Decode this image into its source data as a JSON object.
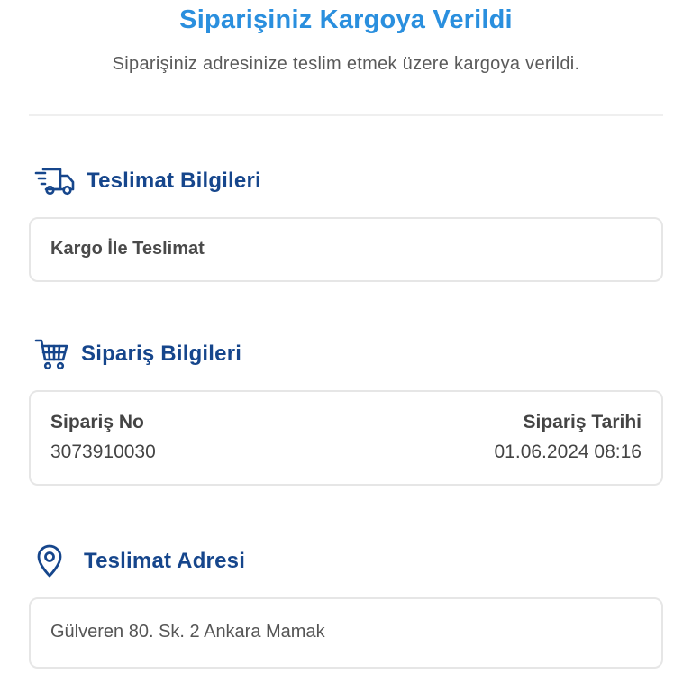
{
  "header": {
    "title": "Siparişiniz Kargoya Verildi",
    "subtitle": "Siparişiniz adresinize teslim etmek üzere kargoya verildi."
  },
  "delivery": {
    "icon": "delivery-truck-icon",
    "title": "Teslimat Bilgileri",
    "method": "Kargo İle Teslimat"
  },
  "order": {
    "icon": "shopping-cart-icon",
    "title": "Sipariş Bilgileri",
    "number_label": "Sipariş No",
    "number_value": "3073910030",
    "date_label": "Sipariş Tarihi",
    "date_value": "01.06.2024 08:16"
  },
  "address": {
    "icon": "location-pin-icon",
    "title": "Teslimat Adresi",
    "text": "Gülveren 80. Sk. 2 Ankara Mamak"
  },
  "colors": {
    "title_blue": "#2a8fde",
    "section_navy": "#16468c",
    "card_border": "#e6e6e6"
  }
}
